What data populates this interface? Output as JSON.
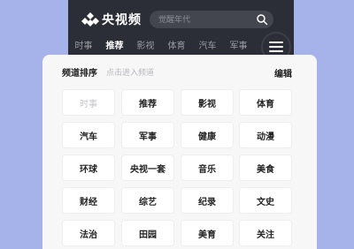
{
  "header": {
    "brand": "央视频",
    "search_placeholder": "觉醒年代"
  },
  "channel_bar": [
    "时事",
    "推荐",
    "影视",
    "体育",
    "汽车",
    "军事"
  ],
  "channel_bar_active": "推荐",
  "sheet": {
    "title": "频道排序",
    "hint": "点击进入频道",
    "edit_label": "编辑",
    "tiles": [
      {
        "label": "时事",
        "disabled": true
      },
      {
        "label": "推荐",
        "disabled": false
      },
      {
        "label": "影视",
        "disabled": false
      },
      {
        "label": "体育",
        "disabled": false
      },
      {
        "label": "汽车",
        "disabled": false
      },
      {
        "label": "军事",
        "disabled": false
      },
      {
        "label": "健康",
        "disabled": false
      },
      {
        "label": "动漫",
        "disabled": false
      },
      {
        "label": "环球",
        "disabled": false
      },
      {
        "label": "央视一套",
        "disabled": false
      },
      {
        "label": "音乐",
        "disabled": false
      },
      {
        "label": "美食",
        "disabled": false
      },
      {
        "label": "财经",
        "disabled": false
      },
      {
        "label": "综艺",
        "disabled": false
      },
      {
        "label": "纪录",
        "disabled": false
      },
      {
        "label": "文史",
        "disabled": false
      },
      {
        "label": "法治",
        "disabled": false
      },
      {
        "label": "田园",
        "disabled": false
      },
      {
        "label": "美育",
        "disabled": false
      },
      {
        "label": "关注",
        "disabled": false
      }
    ]
  },
  "colors": {
    "background": "#a6b2ea",
    "dark_bar": "#2b2e36",
    "sheet": "#f7f7f8"
  }
}
